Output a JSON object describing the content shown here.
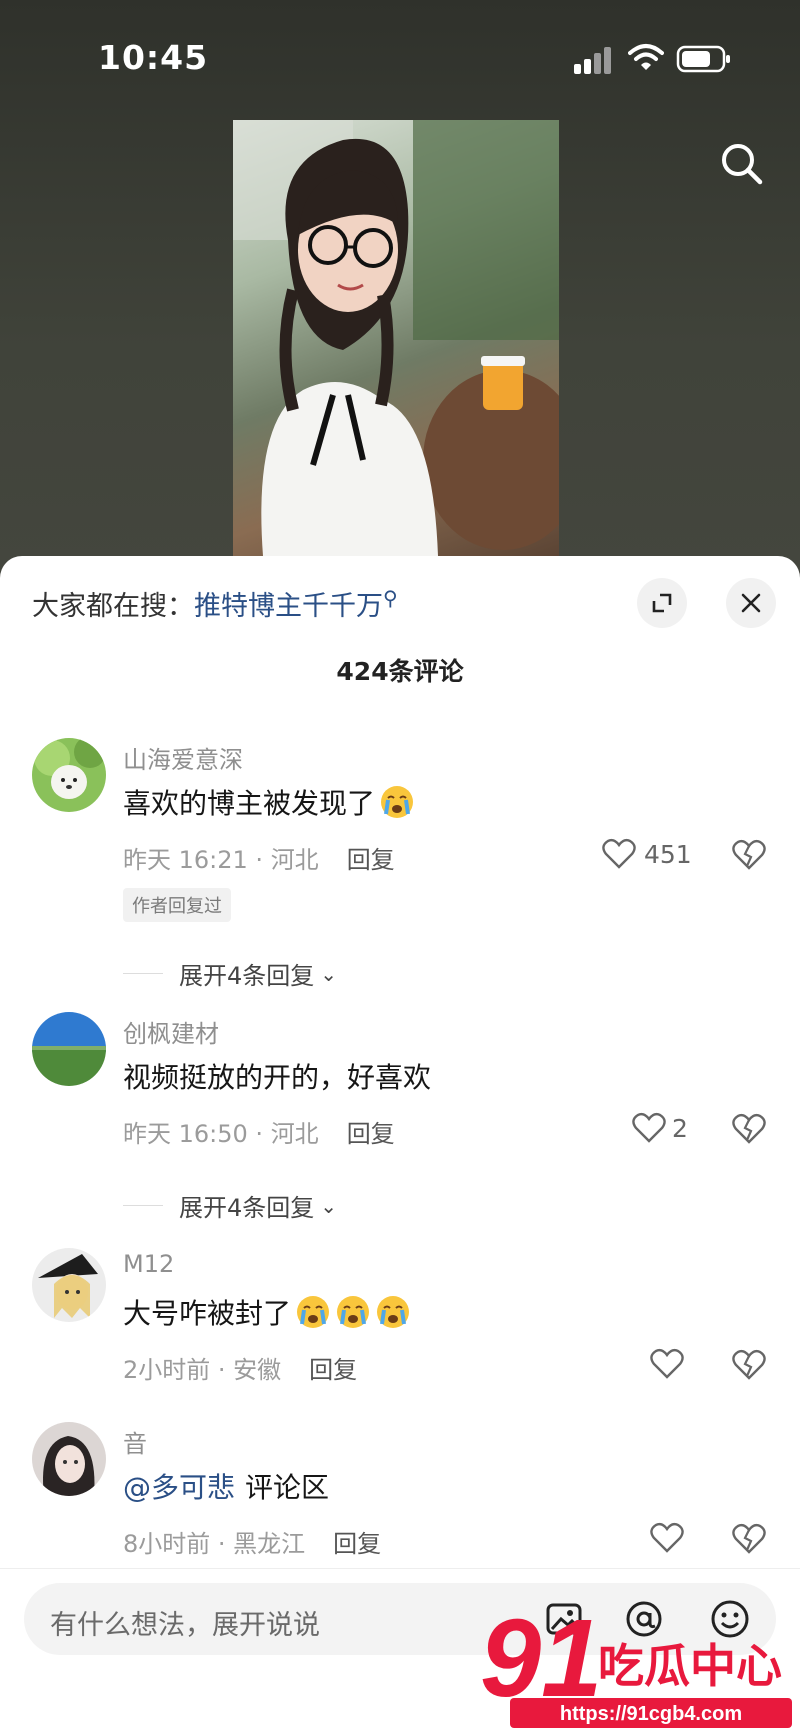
{
  "status_bar": {
    "time": "10:45"
  },
  "hot_search": {
    "prefix": "大家都在搜：",
    "keyword": "推特博主千千万"
  },
  "comments_header": {
    "count_label": "424条评论"
  },
  "comments": [
    {
      "username": "山海爱意深",
      "text": "喜欢的博主被发现了",
      "emoji_count": 1,
      "time": "昨天 16:21",
      "location": "河北",
      "reply_label": "回复",
      "likes": "451",
      "author_replied": "作者回复过",
      "expand_label": "展开4条回复"
    },
    {
      "username": "创枫建材",
      "text": "视频挺放的开的，好喜欢",
      "time": "昨天 16:50",
      "location": "河北",
      "reply_label": "回复",
      "likes": "2",
      "expand_label": "展开4条回复"
    },
    {
      "username": "M12",
      "text": "大号咋被封了",
      "emoji_count": 3,
      "time": "2小时前",
      "location": "安徽",
      "reply_label": "回复",
      "likes": ""
    },
    {
      "username": "音",
      "mention": "@多可悲",
      "text": "评论区",
      "time": "8小时前",
      "location": "黑龙江",
      "reply_label": "回复",
      "likes": ""
    }
  ],
  "input_bar": {
    "placeholder": "有什么想法，展开说说"
  },
  "watermark": {
    "brand": "91吃瓜中心",
    "url": "https://91cgb4.com"
  },
  "icons": {
    "search": "search-icon",
    "expand": "expand-icon",
    "close": "close-icon",
    "like": "heart-icon",
    "dislike": "broken-heart-icon",
    "image": "image-icon",
    "mention": "at-icon",
    "emoji": "emoji-icon"
  },
  "colors": {
    "link": "#2a4f86",
    "sheet_bg": "#ffffff",
    "watermark": "#e8193d"
  }
}
